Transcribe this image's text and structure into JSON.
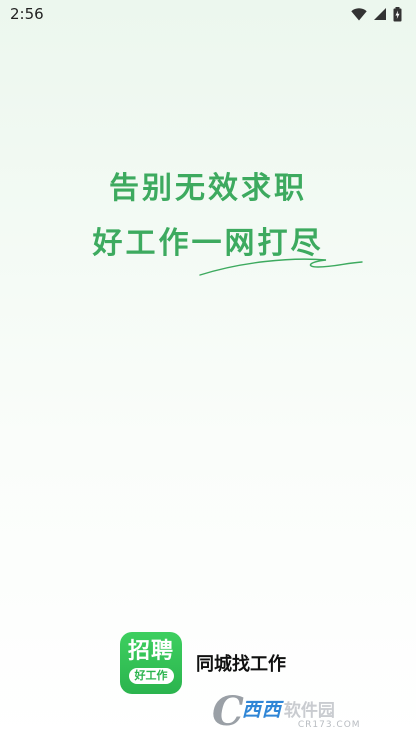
{
  "status_bar": {
    "time": "2:56",
    "icons": [
      "wifi-icon",
      "cellular-signal-icon",
      "battery-charging-icon"
    ]
  },
  "splash": {
    "slogan_line_1": "告别无效求职",
    "slogan_line_2": "好工作一网打尽",
    "accent_color": "#3daa5f"
  },
  "brand": {
    "logo_main": "招聘",
    "logo_sub": "好工作",
    "app_name": "同城找工作",
    "logo_color": "#2bb44e"
  },
  "watermark": {
    "letter": "C",
    "site_highlight": "西西",
    "site_rest": "软件园",
    "domain": "CR173.COM"
  }
}
